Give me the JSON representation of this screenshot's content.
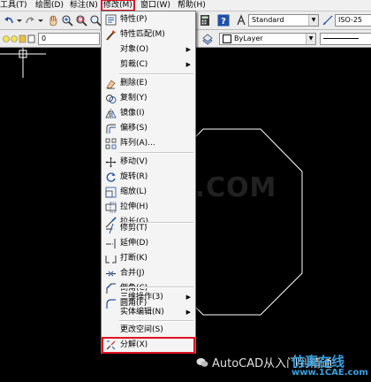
{
  "menubar": {
    "items": [
      "工具(T)",
      "绘图(D)",
      "标注(N)",
      "修改(M)",
      "窗口(W)",
      "帮助(H)"
    ],
    "active_index": 3
  },
  "toolbar": {
    "text_style": "Standard",
    "dim_style": "ISO-25",
    "layer_value": "0",
    "linetype": "ByLayer"
  },
  "modify_menu": {
    "items": [
      {
        "label": "特性(P)",
        "icon": "properties-icon"
      },
      {
        "label": "特性匹配(M)",
        "icon": "match-properties-icon"
      },
      {
        "label": "对象(O)",
        "submenu": true
      },
      {
        "label": "剪裁(C)",
        "submenu": true
      },
      {
        "label": "删除(E)",
        "icon": "erase-icon"
      },
      {
        "label": "复制(Y)",
        "icon": "copy-icon"
      },
      {
        "label": "镜像(I)",
        "icon": "mirror-icon"
      },
      {
        "label": "偏移(S)",
        "icon": "offset-icon"
      },
      {
        "label": "阵列(A)...",
        "icon": "array-icon"
      },
      {
        "label": "移动(V)",
        "icon": "move-icon"
      },
      {
        "label": "旋转(R)",
        "icon": "rotate-icon"
      },
      {
        "label": "缩放(L)",
        "icon": "scale-icon"
      },
      {
        "label": "拉伸(H)",
        "icon": "stretch-icon"
      },
      {
        "label": "拉长(G)",
        "icon": "lengthen-icon"
      },
      {
        "label": "修剪(T)",
        "icon": "trim-icon"
      },
      {
        "label": "延伸(D)",
        "icon": "extend-icon"
      },
      {
        "label": "打断(K)",
        "icon": "break-icon"
      },
      {
        "label": "合并(J)",
        "icon": "join-icon"
      },
      {
        "label": "倒角(C)",
        "icon": "chamfer-icon"
      },
      {
        "label": "圆角(F)",
        "icon": "fillet-icon"
      },
      {
        "label": "三维操作(3)",
        "submenu": true
      },
      {
        "label": "实体编辑(N)",
        "submenu": true
      },
      {
        "label": "更改空间(S)"
      },
      {
        "label": "分解(X)",
        "icon": "explode-icon",
        "highlighted": true
      }
    ]
  },
  "watermark": "1CAE.COM",
  "footer": {
    "caption": "AutoCAD从入门到精通",
    "brand_logo": "仿真在线",
    "brand_site": "www.1CAE.com"
  },
  "colors": {
    "highlight_box": "#e01020",
    "canvas_bg": "#000000",
    "drawing_line": "#ffffff"
  }
}
